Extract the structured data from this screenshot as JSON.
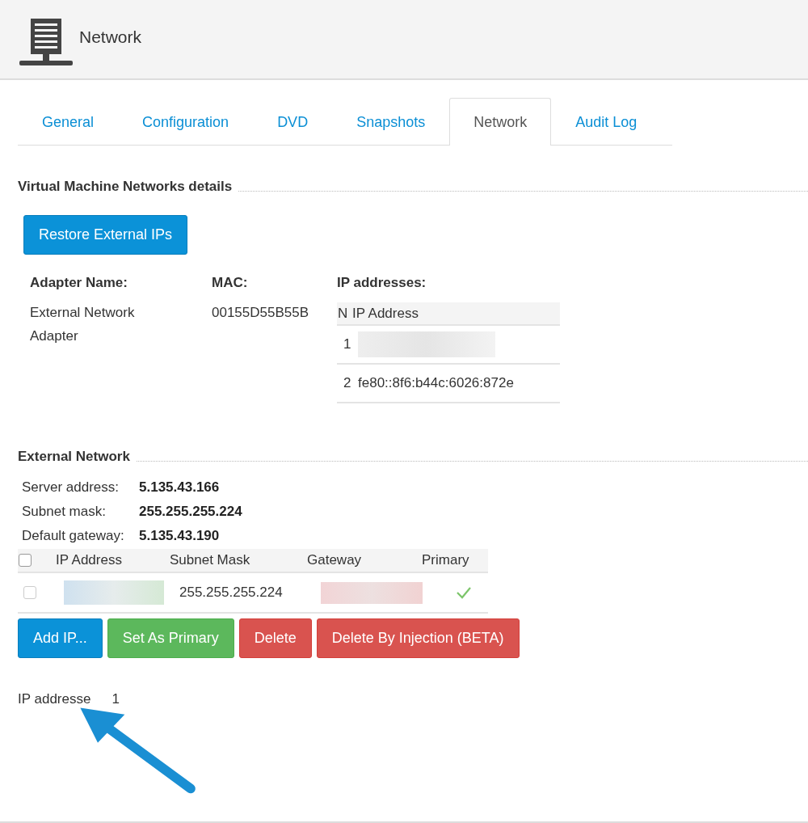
{
  "header": {
    "title": "Network"
  },
  "tabs": [
    {
      "label": "General",
      "selected": false
    },
    {
      "label": "Configuration",
      "selected": false
    },
    {
      "label": "DVD",
      "selected": false
    },
    {
      "label": "Snapshots",
      "selected": false
    },
    {
      "label": "Network",
      "selected": true
    },
    {
      "label": "Audit Log",
      "selected": false
    }
  ],
  "vm_networks": {
    "title": "Virtual Machine Networks details",
    "restore_button": "Restore External IPs",
    "columns": [
      "Adapter Name:",
      "MAC:",
      "IP addresses:"
    ],
    "adapter_name": "External Network Adapter",
    "mac": "00155D55B55B",
    "ip_table": {
      "columns": [
        "N",
        "IP Address"
      ],
      "rows": [
        {
          "n": "1",
          "kind": "redacted"
        },
        {
          "n": "2",
          "kind": "text",
          "ip": "fe80::8f6:b44c:6026:872e"
        }
      ]
    }
  },
  "external_network": {
    "title": "External Network",
    "info": [
      {
        "label": "Server address:",
        "value": "5.135.43.166"
      },
      {
        "label": "Subnet mask:",
        "value": "255.255.255.224"
      },
      {
        "label": "Default gateway:",
        "value": "5.135.43.190"
      }
    ],
    "table": {
      "select_all_checked": false,
      "columns": [
        "IP Address",
        "Subnet Mask",
        "Gateway",
        "Primary"
      ],
      "rows": [
        {
          "checked": false,
          "cells": [
            {
              "kind": "redacted"
            },
            {
              "kind": "text",
              "text": "255.255.255.224"
            },
            {
              "kind": "redacted"
            }
          ],
          "primary": true
        }
      ]
    },
    "buttons": [
      {
        "label": "Add IP...",
        "kind": "primary"
      },
      {
        "label": "Set As Primary",
        "kind": "success"
      },
      {
        "label": "Delete",
        "kind": "danger"
      },
      {
        "label": "Delete By Injection (BETA)",
        "kind": "danger"
      }
    ],
    "count_label": "IP addresse",
    "count_value": "1"
  }
}
